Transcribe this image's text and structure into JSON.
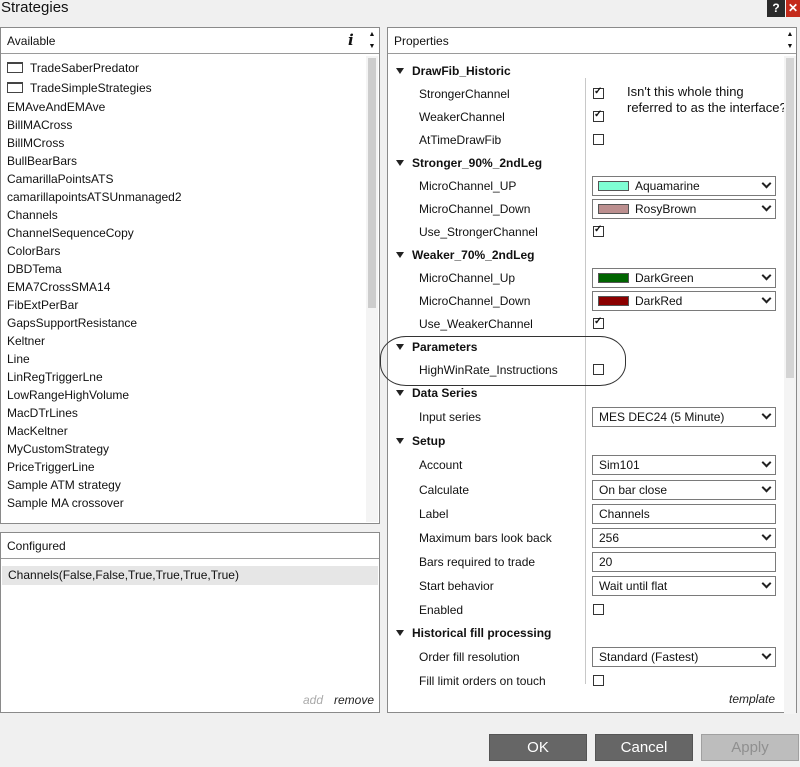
{
  "window": {
    "title": "Strategies",
    "help_label": "?",
    "close_label": "✕"
  },
  "available": {
    "header": "Available",
    "info_label": "i",
    "folders": [
      "TradeSaberPredator",
      "TradeSimpleStrategies"
    ],
    "items": [
      "EMAveAndEMAve",
      "BillMACross",
      "BillMCross",
      "BullBearBars",
      "CamarillaPointsATS",
      "camarillapointsATSUnmanaged2",
      "Channels",
      "ChannelSequenceCopy",
      "ColorBars",
      "DBDTema",
      "EMA7CrossSMA14",
      "FibExtPerBar",
      "GapsSupportResistance",
      "Keltner",
      "Line",
      "LinRegTriggerLne",
      "LowRangeHighVolume",
      "MacDTrLines",
      "MacKeltner",
      "MyCustomStrategy",
      "PriceTriggerLine",
      "Sample ATM strategy",
      "Sample MA crossover"
    ]
  },
  "configured": {
    "header": "Configured",
    "row": "Channels(False,False,True,True,True,True)",
    "add_label": "add",
    "remove_label": "remove"
  },
  "properties": {
    "header": "Properties",
    "annotation": "Isn't this whole thing referred to as the interface?",
    "template_label": "template",
    "categories": {
      "drawfib": "DrawFib_Historic",
      "stronger": "Stronger_90%_2ndLeg",
      "weaker": "Weaker_70%_2ndLeg",
      "parameters": "Parameters",
      "dataseries": "Data Series",
      "setup": "Setup",
      "histfill": "Historical fill processing"
    },
    "labels": {
      "stronger_channel": "StrongerChannel",
      "weaker_channel": "WeakerChannel",
      "at_time_drawfib": "AtTimeDrawFib",
      "mc_up_stronger": "MicroChannel_UP",
      "mc_down_stronger": "MicroChannel_Down",
      "use_stronger": "Use_StrongerChannel",
      "mc_up_weaker": "MicroChannel_Up",
      "mc_down_weaker": "MicroChannel_Down",
      "use_weaker": "Use_WeakerChannel",
      "highwinrate": "HighWinRate_Instructions",
      "input_series": "Input series",
      "account": "Account",
      "calculate": "Calculate",
      "label": "Label",
      "max_bars": "Maximum bars look back",
      "bars_required": "Bars required to trade",
      "start_behavior": "Start behavior",
      "enabled": "Enabled",
      "order_fill": "Order fill resolution",
      "fill_limit": "Fill limit orders on touch"
    },
    "values": {
      "stronger_channel": true,
      "weaker_channel": true,
      "at_time_drawfib": false,
      "mc_up_stronger": "Aquamarine",
      "mc_down_stronger": "RosyBrown",
      "use_stronger": true,
      "mc_up_weaker": "DarkGreen",
      "mc_down_weaker": "DarkRed",
      "use_weaker": true,
      "highwinrate": false,
      "input_series": "MES DEC24 (5 Minute)",
      "account": "Sim101",
      "calculate": "On bar close",
      "label": "Channels",
      "max_bars": "256",
      "bars_required": "20",
      "start_behavior": "Wait until flat",
      "enabled": false,
      "order_fill": "Standard (Fastest)",
      "fill_limit": false
    },
    "swatch_colors": {
      "aquamarine": "#7fffd4",
      "rosybrown": "#bc8f8f",
      "darkgreen": "#006400",
      "darkred": "#8b0000"
    }
  },
  "buttons": {
    "ok": "OK",
    "cancel": "Cancel",
    "apply": "Apply"
  }
}
